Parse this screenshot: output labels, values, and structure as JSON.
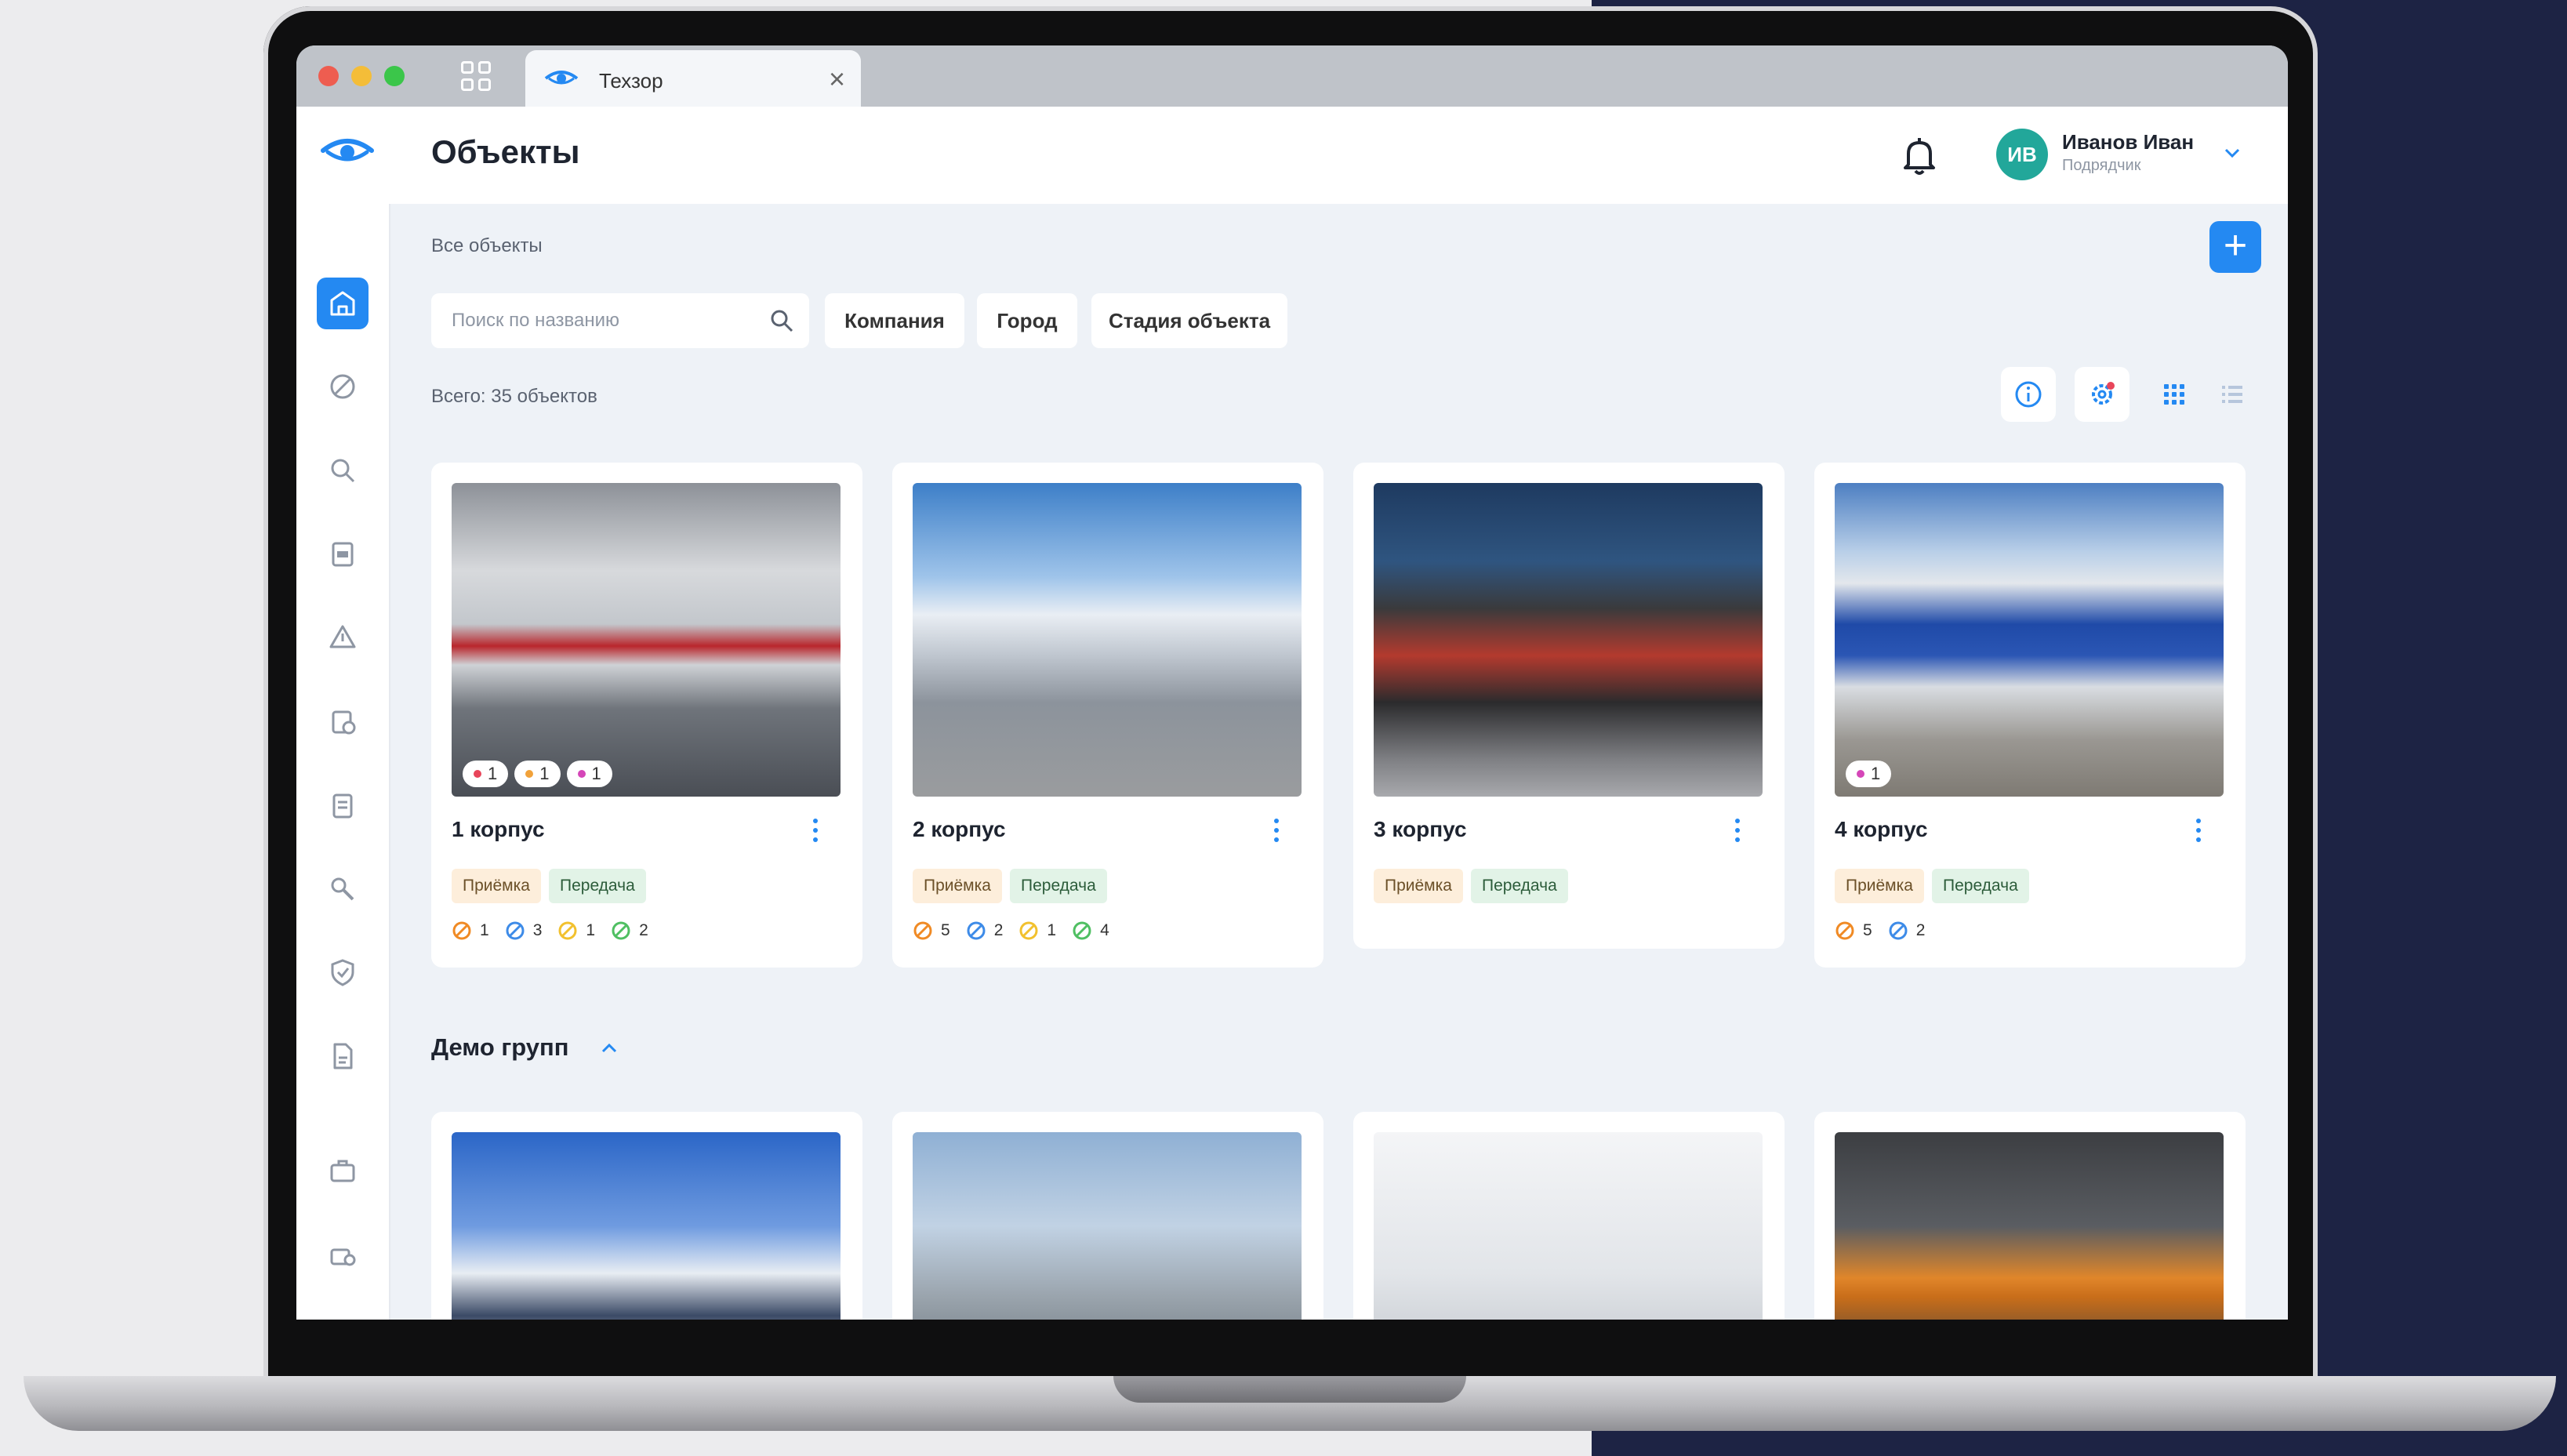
{
  "colors": {
    "accent": "#2489f2",
    "avatar": "#22a79a",
    "navy": "#1d2344",
    "tag_orange": "#fdeedb",
    "tag_green": "#e2f3e7"
  },
  "browser": {
    "tab_title": "Техзор",
    "tab_icon": "eye-logo-icon"
  },
  "header": {
    "title": "Объекты",
    "bell_icon": "bell-icon",
    "user": {
      "initials": "ИВ",
      "name": "Иванов Иван",
      "role": "Подрядчик"
    }
  },
  "sidebar": {
    "items": [
      {
        "icon": "home-icon",
        "active": true
      },
      {
        "icon": "no-entry-icon"
      },
      {
        "icon": "search-icon"
      },
      {
        "icon": "document-icon"
      },
      {
        "icon": "warning-icon"
      },
      {
        "icon": "clipboard-check-icon"
      },
      {
        "icon": "checklist-icon"
      },
      {
        "icon": "tools-icon"
      },
      {
        "icon": "shield-check-icon"
      },
      {
        "icon": "file-text-icon"
      },
      {
        "icon": "briefcase-icon"
      },
      {
        "icon": "user-case-icon"
      },
      {
        "icon": "report-icon"
      }
    ]
  },
  "main": {
    "breadcrumb": "Все объекты",
    "search": {
      "placeholder": "Поиск по названию"
    },
    "filters": [
      "Компания",
      "Город",
      "Стадия объекта"
    ],
    "total": "Всего: 35 объектов",
    "view_icons": [
      "info-icon",
      "settings-gear-icon",
      "grid-view-icon",
      "list-view-icon"
    ],
    "cards": [
      {
        "name": "1 корпус",
        "badges": [
          {
            "color": "#e8455a",
            "count": "1"
          },
          {
            "color": "#f1a23a",
            "count": "1"
          },
          {
            "color": "#d546b8",
            "count": "1"
          }
        ],
        "tags": [
          "Приёмка",
          "Передача"
        ],
        "stats": [
          {
            "color": "#f08a24",
            "count": "1"
          },
          {
            "color": "#3d8be8",
            "count": "3"
          },
          {
            "color": "#f2c12e",
            "count": "1"
          },
          {
            "color": "#4fbf62",
            "count": "2"
          }
        ]
      },
      {
        "name": "2 корпус",
        "badges": [],
        "tags": [
          "Приёмка",
          "Передача"
        ],
        "stats": [
          {
            "color": "#f08a24",
            "count": "5"
          },
          {
            "color": "#3d8be8",
            "count": "2"
          },
          {
            "color": "#f2c12e",
            "count": "1"
          },
          {
            "color": "#4fbf62",
            "count": "4"
          }
        ]
      },
      {
        "name": "3 корпус",
        "badges": [],
        "tags": [
          "Приёмка",
          "Передача"
        ],
        "stats": []
      },
      {
        "name": "4 корпус",
        "badges": [
          {
            "color": "#d546b8",
            "count": "1"
          }
        ],
        "tags": [
          "Приёмка",
          "Передача"
        ],
        "stats": [
          {
            "color": "#f08a24",
            "count": "5"
          },
          {
            "color": "#3d8be8",
            "count": "2"
          }
        ]
      }
    ],
    "group": {
      "title": "Демо групп"
    }
  }
}
